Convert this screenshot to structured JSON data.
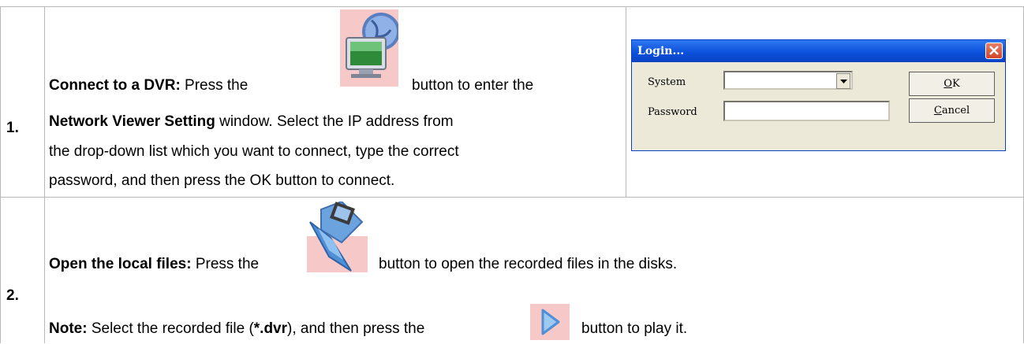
{
  "rows": [
    {
      "number": "1.",
      "lines": [
        {
          "bold": "Connect to a DVR:",
          "text_before_icon": " Press the",
          "text_after_icon": "button to enter the"
        },
        {
          "bold": "Network Viewer Setting",
          "text": " window. Select the IP address from"
        },
        {
          "text": "the drop-down list which you want to connect, type the correct"
        },
        {
          "text": "password, and then press the OK button to connect."
        }
      ],
      "icon": "network-monitor-globe-icon"
    },
    {
      "number": "2.",
      "line1": {
        "bold": "Open the local files:",
        "text_before_icon": " Press the",
        "text_after_icon": "button to open the recorded files in the disks."
      },
      "line2": {
        "bold": "Note:",
        "text1": " Select the recorded file (",
        "bold2": "*.dvr",
        "text2": "), and then press the",
        "text_after_icon": "button to play it."
      },
      "icons": [
        "folder-video-icon",
        "play-icon"
      ]
    }
  ],
  "login_dialog": {
    "title": "Login...",
    "system_label": "System",
    "password_label": "Password",
    "ok_label": "OK",
    "ok_mnemonic": "O",
    "ok_rest": "K",
    "cancel_label": "Cancel",
    "cancel_mnemonic": "C",
    "cancel_rest": "ancel",
    "system_value": "",
    "password_value": ""
  },
  "colors": {
    "title_bar": "#0a4fd8",
    "close_button": "#d2442a",
    "dialog_bg": "#ece9d8",
    "table_border": "#b8b8b8"
  }
}
